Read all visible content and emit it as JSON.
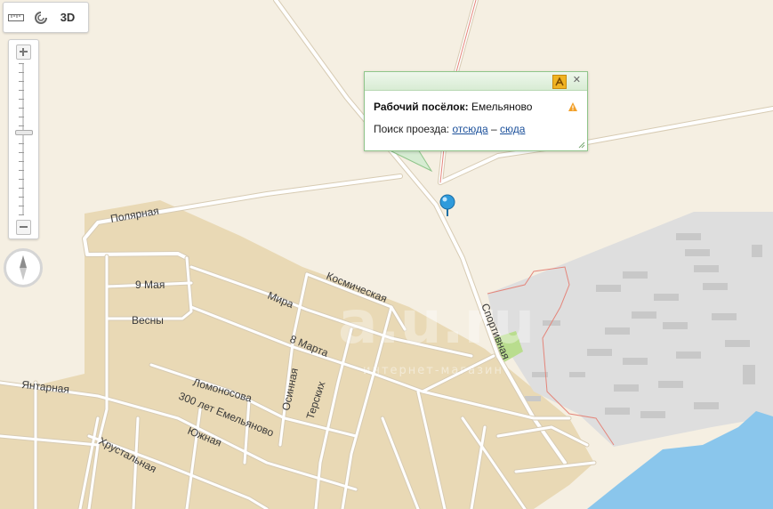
{
  "toolbar": {
    "ruler_icon": "ruler-icon",
    "traffic_icon": "traffic-icon",
    "btn_3d": "3D"
  },
  "zoom": {
    "level_fraction": 0.55,
    "plus_icon": "plus-icon",
    "minus_icon": "minus-icon"
  },
  "compass_icon": "compass-icon",
  "balloon": {
    "place_type": "Рабочий посёлок:",
    "place_name": "Емельяново",
    "route_prefix": "Поиск проезда:",
    "route_from": "отсюда",
    "route_sep": "–",
    "route_to": "сюда",
    "route_icon": "route-icon",
    "warning_icon": "warning-icon",
    "close_icon": "close-icon"
  },
  "marker_icon": "map-pin-icon",
  "streets": {
    "polyarnaya": "Полярная",
    "may9": "9 Мая",
    "vesny": "Весны",
    "mira": "Мира",
    "kosmicheskaya": "Космическая",
    "mart8": "8 Марта",
    "sportivnaya": "Спортивная",
    "lomonosova": "Ломоносова",
    "osinnaya": "Осинная",
    "terskih": "Терских",
    "yantarnaya": "Янтарная",
    "emelyanovo300": "300 лет Емельяново",
    "yuzhnaya": "Южная",
    "hrustalnaya": "Хрустальная"
  },
  "watermark": {
    "main": "a.u.ru",
    "sub": "интернет-магазин"
  },
  "colors": {
    "background": "#f5efe2",
    "residential": "#e9d9b5",
    "industrial": "#dcdcdc",
    "water": "#8ac6ec",
    "road": "#ffffff",
    "accent": "#8fc58a"
  }
}
